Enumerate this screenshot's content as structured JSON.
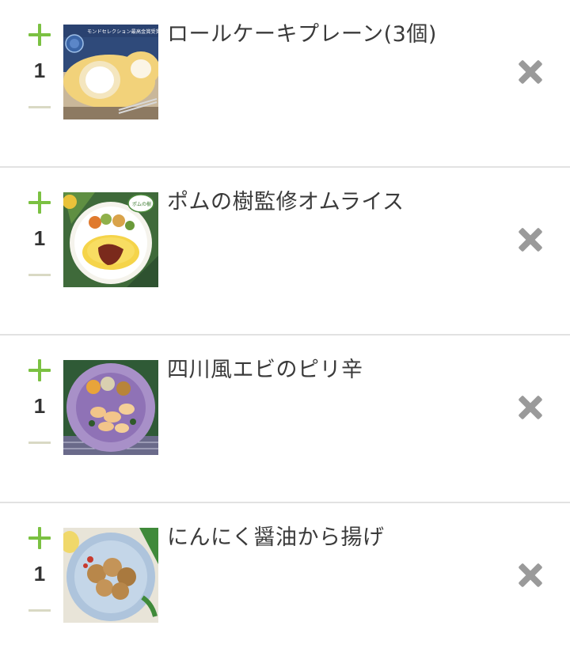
{
  "cart": {
    "items": [
      {
        "name": "ロールケーキプレーン(3個)",
        "quantity": "1",
        "image_badge": "モンドセレクション最高金賞受賞"
      },
      {
        "name": "ポムの樹監修オムライス",
        "quantity": "1",
        "image_badge": "ポムの樹"
      },
      {
        "name": "四川風エビのピリ辛",
        "quantity": "1"
      },
      {
        "name": "にんにく醤油から揚げ",
        "quantity": "1"
      }
    ]
  },
  "colors": {
    "plus": "#7bc142",
    "minus": "#d9d9c4",
    "remove": "#9a9a9a",
    "divider": "#e2e2e2",
    "text": "#3a3a3a"
  },
  "icons": {
    "increase": "plus-icon",
    "decrease": "minus-icon",
    "remove": "close-icon"
  }
}
